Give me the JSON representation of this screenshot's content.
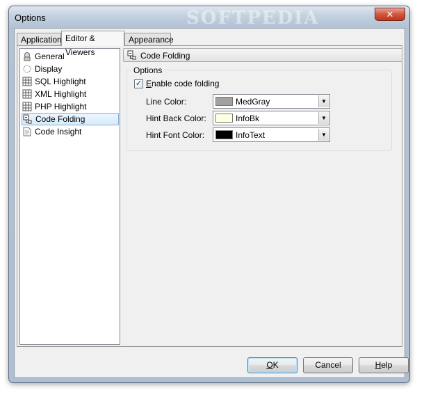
{
  "window": {
    "title": "Options",
    "watermark": "SOFTPEDIA",
    "close_glyph": "✕"
  },
  "tabs": [
    {
      "label": "Application",
      "active": false
    },
    {
      "label": "Editor & Viewers",
      "active": true
    },
    {
      "label": "Appearance",
      "active": false
    }
  ],
  "tree": {
    "items": [
      {
        "label": "General",
        "icon": "general-icon"
      },
      {
        "label": "Display",
        "icon": "display-icon"
      },
      {
        "label": "SQL Highlight",
        "icon": "grid-icon"
      },
      {
        "label": "XML Highlight",
        "icon": "grid-icon"
      },
      {
        "label": "PHP Highlight",
        "icon": "grid-icon"
      },
      {
        "label": "Code Folding",
        "icon": "code-folding-icon",
        "selected": true
      },
      {
        "label": "Code Insight",
        "icon": "code-insight-icon"
      }
    ]
  },
  "pane": {
    "header_title": "Code Folding",
    "group_title": "Options",
    "enable_checkbox": {
      "label_underlined": "E",
      "label_rest": "nable code folding",
      "checked": true
    },
    "fields": [
      {
        "label": "Line Color:",
        "value": "MedGray",
        "swatch": "#a4a0a0"
      },
      {
        "label": "Hint Back Color:",
        "value": "InfoBk",
        "swatch": "#ffffe1"
      },
      {
        "label": "Hint Font Color:",
        "value": "InfoText",
        "swatch": "#000000"
      }
    ]
  },
  "buttons": {
    "ok": {
      "underlined": "O",
      "rest": "K"
    },
    "cancel": {
      "label": "Cancel"
    },
    "help": {
      "underlined": "H",
      "rest": "elp"
    }
  },
  "colors": {
    "selection_border": "#84acdd",
    "close_button": "#c0341c"
  }
}
